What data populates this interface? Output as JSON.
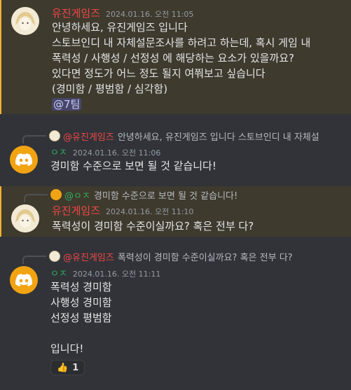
{
  "messages": [
    {
      "username": "유진게임즈",
      "timestamp": "2024.01.16. 오전 11:05",
      "lines": [
        "안녕하세요, 유진게임즈 입니다",
        "스토브인디 내 자체설문조사를 하려고 하는데, 혹시 게임 내",
        "폭력성 / 사행성 / 선정성 에 해당하는 요소가 있을까요?",
        "있다면 정도가 어느 정도 될지 여쭤보고 싶습니다",
        "(경미함 / 평범함 / 심각함)"
      ],
      "role_mention": "@7팀"
    },
    {
      "reply": {
        "name": "@유진게임즈",
        "text": "안녕하세요, 유진게임즈 입니다 스토브인디 내 자체설"
      },
      "username": "ㅇㅈ",
      "timestamp": "2024.01.16. 오전 11:06",
      "lines": [
        "경미함 수준으로 보면 될 것 같습니다!"
      ]
    },
    {
      "reply": {
        "name": "@ㅇㅈ",
        "text": "경미함 수준으로 보면 될 것 같습니다!"
      },
      "username": "유진게임즈",
      "timestamp": "2024.01.16. 오전 11:10",
      "lines": [
        "폭력성이 경미함 수준이실까요? 혹은 전부 다?"
      ]
    },
    {
      "reply": {
        "name": "@유진게임즈",
        "text": "폭력성이 경미함 수준이실까요? 혹은 전부 다?"
      },
      "username": "ㅇㅈ",
      "timestamp": "2024.01.16. 오전 11:11",
      "lines": [
        "폭력성 경미함",
        "사행성 경미함",
        "선정성 평범함",
        "",
        "입니다!"
      ],
      "reaction": {
        "emoji": "👍",
        "count": "1"
      }
    }
  ],
  "icons": {
    "discord_avatar": "discord-logo-icon",
    "reaction": "thumbs-up-icon"
  },
  "colors": {
    "background": "#313338",
    "mention_highlight": "#3f3a2e",
    "mention_bar": "#f0b232",
    "username_red": "#f04747",
    "username_green": "#2fb15f",
    "discord_orange": "#f2a312"
  }
}
